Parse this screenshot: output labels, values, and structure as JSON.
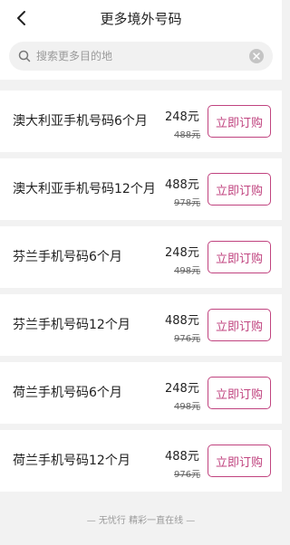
{
  "header": {
    "title": "更多境外号码",
    "back_icon": "chevron-left-icon"
  },
  "search": {
    "placeholder": "搜索更多目的地",
    "value": "",
    "search_icon": "search-icon",
    "clear_icon": "close-circle-icon"
  },
  "products": [
    {
      "name": "澳大利亚手机号码6个月",
      "price": "248元",
      "original_price": "488元",
      "button": "立即订购"
    },
    {
      "name": "澳大利亚手机号码12个月",
      "price": "488元",
      "original_price": "978元",
      "button": "立即订购"
    },
    {
      "name": "芬兰手机号码6个月",
      "price": "248元",
      "original_price": "498元",
      "button": "立即订购"
    },
    {
      "name": "芬兰手机号码12个月",
      "price": "488元",
      "original_price": "976元",
      "button": "立即订购"
    },
    {
      "name": "荷兰手机号码6个月",
      "price": "248元",
      "original_price": "498元",
      "button": "立即订购"
    },
    {
      "name": "荷兰手机号码12个月",
      "price": "488元",
      "original_price": "976元",
      "button": "立即订购"
    }
  ],
  "footer": {
    "text": "— 无忧行 精彩一直在线 —"
  },
  "colors": {
    "accent": "#c0437f",
    "background": "#f2f2f2"
  }
}
